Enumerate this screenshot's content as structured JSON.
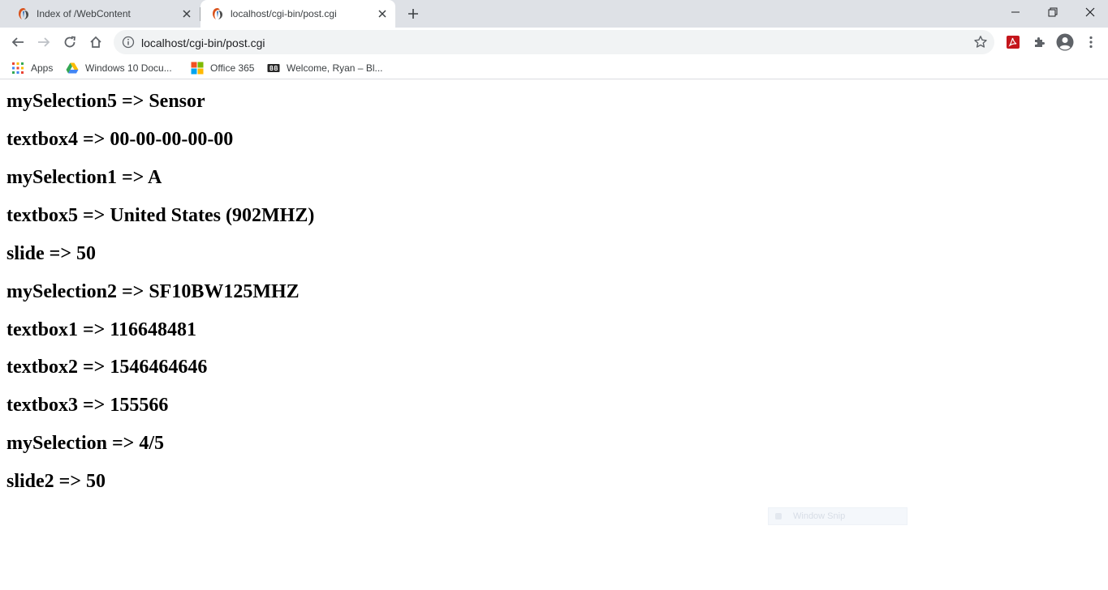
{
  "browser": {
    "tabs": [
      {
        "title": "Index of /WebContent",
        "active": false,
        "icon": "site-favicon"
      },
      {
        "title": "localhost/cgi-bin/post.cgi",
        "active": true,
        "icon": "site-favicon"
      }
    ],
    "url": "localhost/cgi-bin/post.cgi",
    "bookmarks": [
      {
        "label": "Apps",
        "icon": "apps-grid-icon"
      },
      {
        "label": "Windows 10 Docu...",
        "icon": "google-drive-icon"
      },
      {
        "label": "Office 365",
        "icon": "microsoft-icon"
      },
      {
        "label": "Welcome, Ryan – Bl...",
        "icon": "blackboard-icon"
      }
    ]
  },
  "page": {
    "entries": [
      "mySelection5 => Sensor",
      "textbox4 => 00-00-00-00-00",
      "mySelection1 => A",
      "textbox5 => United States (902MHZ)",
      "slide => 50",
      "mySelection2 => SF10BW125MHZ",
      "textbox1 => 116648481",
      "textbox2 => 1546464646",
      "textbox3 => 155566",
      "mySelection => 4/5",
      "slide2 => 50"
    ]
  },
  "overlay": {
    "snip_label": "Window Snip"
  }
}
